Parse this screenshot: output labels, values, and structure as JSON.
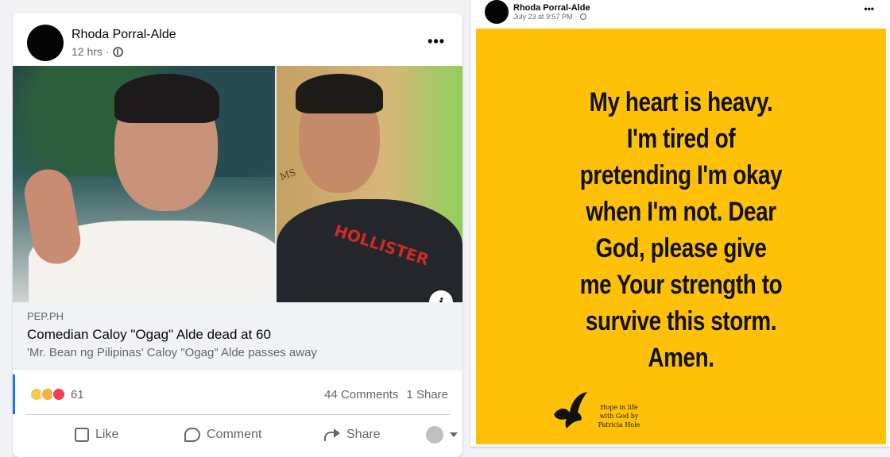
{
  "left_post": {
    "author": "Rhoda Porral-Alde",
    "time": "12 hrs",
    "privacy_icon": "globe-icon",
    "more": "•••",
    "link": {
      "domain": "PEP.PH",
      "title": "Comedian Caloy \"Ogag\" Alde dead at 60",
      "subtitle": "'Mr. Bean ng Pilipinas' Caloy \"Ogag\" Alde passes away",
      "info_icon": "i",
      "photo_logo_text": "HOLLISTER",
      "photo_sign_text": "MS"
    },
    "reactions": {
      "icons": [
        "sad-reaction-icon",
        "care-reaction-icon",
        "love-reaction-icon"
      ],
      "count": "61",
      "comments": "44 Comments",
      "shares": "1 Share"
    },
    "actions": {
      "like": "Like",
      "comment": "Comment",
      "share": "Share"
    }
  },
  "right_post": {
    "author": "Rhoda Porral-Alde",
    "time": "July 23 at 9:57 PM",
    "more": "•••",
    "quote_lines": [
      "My heart is heavy.",
      "I'm tired of",
      "pretending I'm okay",
      "when I'm not. Dear",
      "God, please give",
      "me Your strength to",
      "survive this storm.",
      "Amen."
    ],
    "signature_lines": [
      "Hope in life",
      "with God by",
      "Patricia Hole"
    ],
    "colors": {
      "background": "#ffc107",
      "text": "#111111"
    }
  }
}
